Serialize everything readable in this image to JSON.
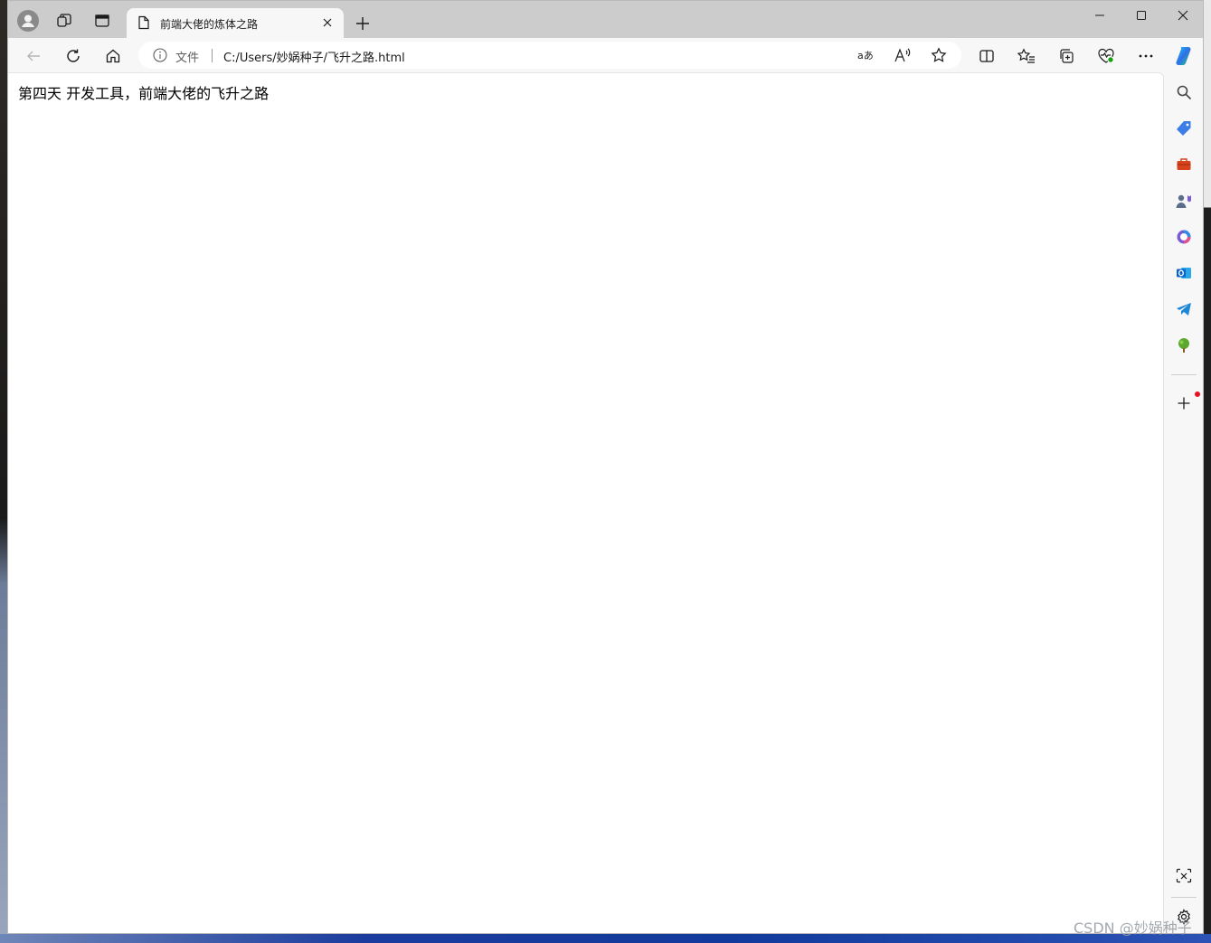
{
  "tab": {
    "title": "前端大佬的炼体之路"
  },
  "address": {
    "scheme_label": "文件",
    "url": "C:/Users/妙娲种子/飞升之路.html"
  },
  "content": {
    "body_text": "第四天 开发工具，前端大佬的飞升之路"
  },
  "watermark": {
    "text": "CSDN @妙娲种子"
  },
  "colors": {
    "accent_red": "#e81123",
    "toolbar_bg": "#f7f7f7",
    "tab_strip_bg": "#cccccc"
  },
  "icons": {
    "title_bar": [
      "profile-avatar-icon",
      "workspaces-icon",
      "vertical-tabs-icon",
      "page-icon",
      "close-icon",
      "plus-icon",
      "minimize-icon",
      "maximize-icon",
      "close-window-icon"
    ],
    "toolbar": [
      "back-arrow-icon",
      "refresh-icon",
      "home-icon",
      "info-icon",
      "translate-icon",
      "read-aloud-icon",
      "star-icon",
      "split-screen-icon",
      "favorites-icon",
      "collections-icon",
      "performance-icon",
      "more-icon",
      "copilot-icon"
    ],
    "sidebar": [
      "search-icon",
      "shopping-tag-icon",
      "tools-briefcase-icon",
      "games-icon",
      "office-icon",
      "outlook-icon",
      "telegram-icon",
      "tree-icon",
      "add-icon",
      "screenshot-icon",
      "settings-gear-icon"
    ]
  }
}
